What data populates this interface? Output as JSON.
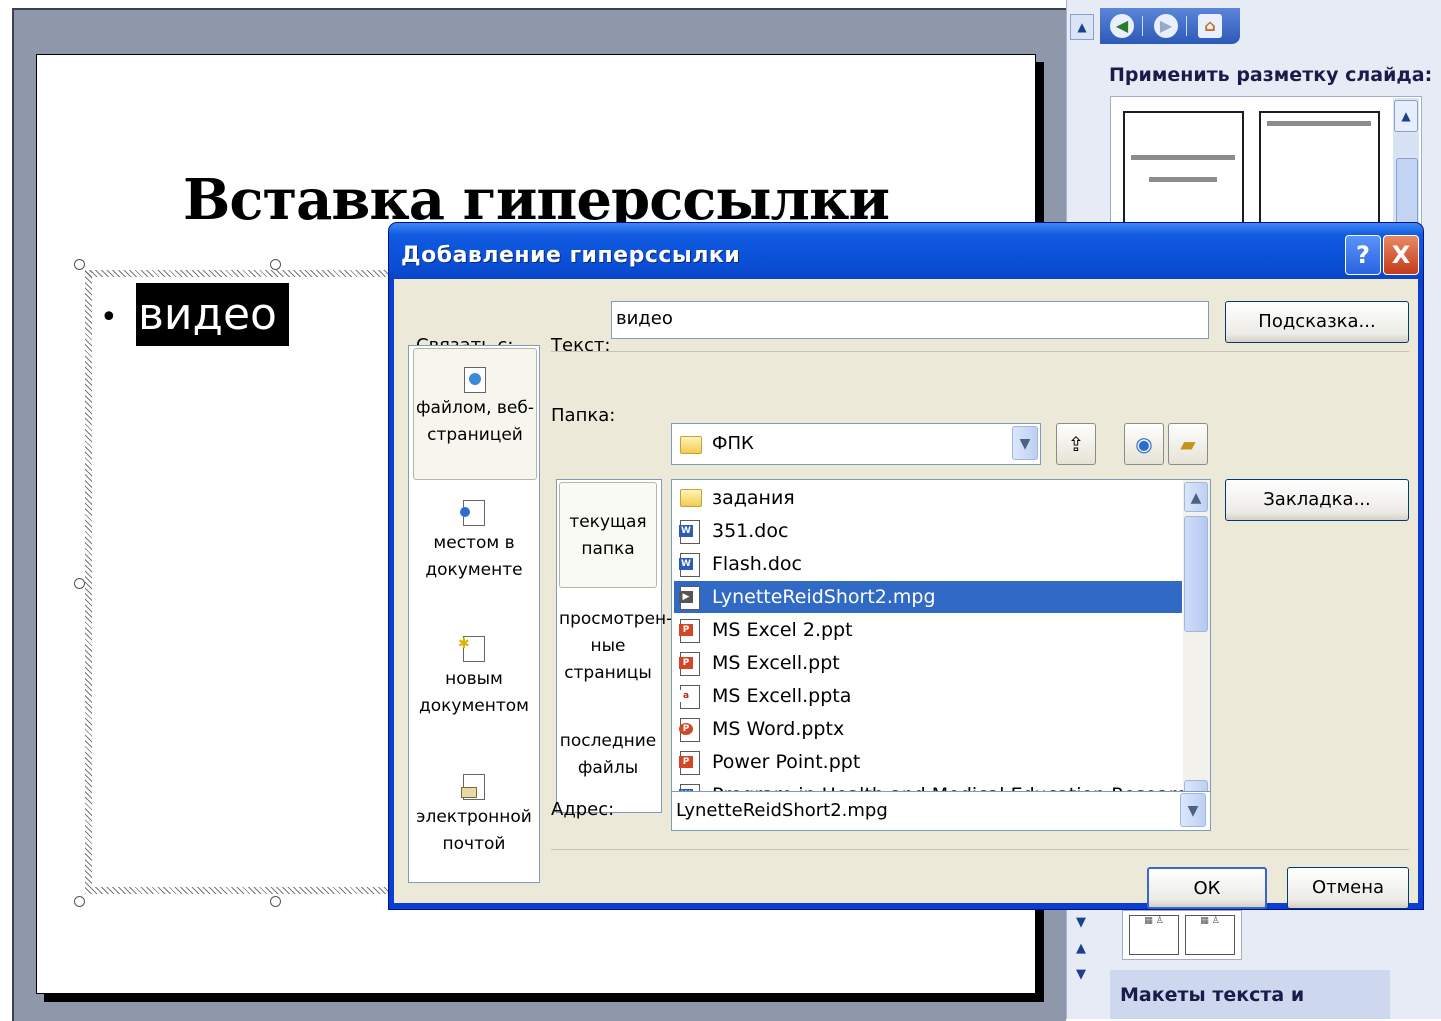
{
  "slide": {
    "title": "Вставка гиперссылки",
    "bullet_text": "видео"
  },
  "taskpane": {
    "apply_layout_label": "Применить разметку слайда:",
    "section_label": "Макеты текста и"
  },
  "dialog": {
    "title": "Добавление гиперссылки",
    "help_glyph": "?",
    "close_glyph": "X",
    "link_to_label": "Связать с:",
    "text_label": "Текст:",
    "text_value": "видео",
    "hint_button": "Подсказка...",
    "folder_label": "Папка:",
    "folder_value": "ФПК",
    "bookmark_button": "Закладка...",
    "address_label": "Адрес:",
    "address_value": "LynetteReidShort2.mpg",
    "ok_button": "ОК",
    "cancel_button": "Отмена",
    "link_targets": [
      {
        "label": "файлом, веб-страницей",
        "icon": "globe-page-icon",
        "selected": true
      },
      {
        "label": "местом в документе",
        "icon": "document-place-icon",
        "selected": false
      },
      {
        "label": "новым документом",
        "icon": "new-document-icon",
        "selected": false
      },
      {
        "label": "электронной почтой",
        "icon": "email-icon",
        "selected": false
      }
    ],
    "places": [
      {
        "label": "текущая папка",
        "selected": true
      },
      {
        "label": "просмотрен-ные страницы",
        "selected": false
      },
      {
        "label": "последние файлы",
        "selected": false
      }
    ],
    "files": [
      {
        "name": "задания",
        "icon": "folder-icon",
        "selected": false
      },
      {
        "name": "351.doc",
        "icon": "word-doc-icon",
        "selected": false
      },
      {
        "name": "Flash.doc",
        "icon": "word-doc-icon",
        "selected": false
      },
      {
        "name": "LynetteReidShort2.mpg",
        "icon": "video-file-icon",
        "selected": true
      },
      {
        "name": "MS Excel 2.ppt",
        "icon": "powerpoint-icon",
        "selected": false
      },
      {
        "name": "MS Excell.ppt",
        "icon": "powerpoint-icon",
        "selected": false
      },
      {
        "name": "MS Excell.ppta",
        "icon": "generic-file-icon",
        "selected": false
      },
      {
        "name": "MS Word.pptx",
        "icon": "powerpoint-x-icon",
        "selected": false
      },
      {
        "name": "Power Point.ppt",
        "icon": "powerpoint-icon",
        "selected": false
      },
      {
        "name": "Program in Health and Medical Education Research.doc",
        "icon": "word-doc-icon",
        "selected": false
      }
    ]
  },
  "colors": {
    "titlebar": "#0a4ed5",
    "selection": "#316ac5",
    "dialog_face": "#ece9d8",
    "workspace": "#8f97ab"
  }
}
